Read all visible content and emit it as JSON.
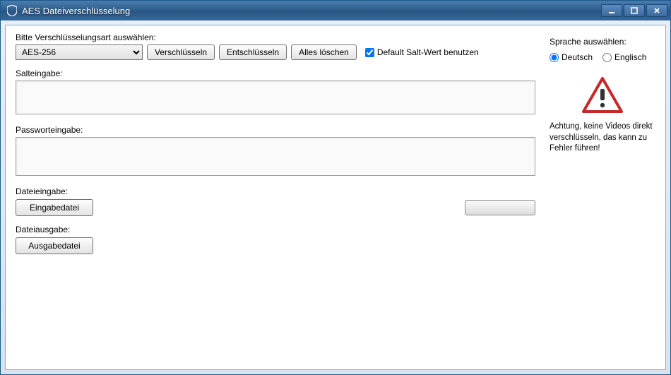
{
  "window": {
    "title": "AES Dateiverschlüsselung"
  },
  "toolbar": {
    "prompt": "Bitte Verschlüsselungsart auswählen:",
    "algorithm": "AES-256",
    "encrypt": "Verschlüsseln",
    "decrypt": "Entschlüsseln",
    "clear": "Alles löschen",
    "default_salt": "Default Salt-Wert benutzen"
  },
  "fields": {
    "salt_label": "Salteingabe:",
    "salt_value": "",
    "password_label": "Passworteingabe:",
    "password_value": "",
    "file_in_label": "Dateieingabe:",
    "file_in_btn": "Eingabedatei",
    "file_out_label": "Dateiausgabe:",
    "file_out_btn": "Ausgabedatei"
  },
  "side": {
    "language_label": "Sprache auswählen:",
    "lang_de": "Deutsch",
    "lang_en": "Englisch",
    "warning": "Achtung, keine Videos direkt verschlüsseln, das kann zu Fehler führen!"
  }
}
